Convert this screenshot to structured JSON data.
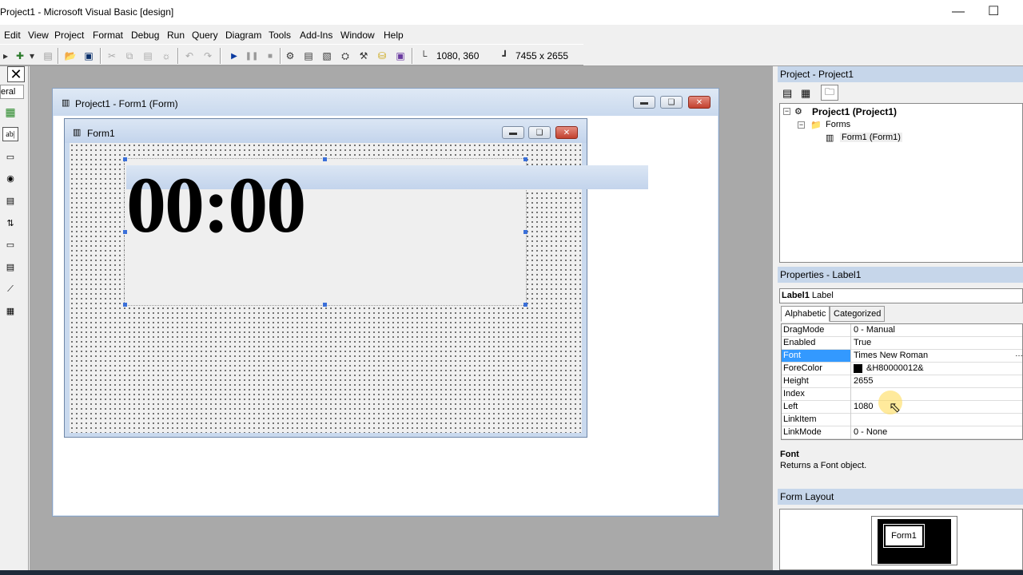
{
  "window": {
    "title": "Project1 - Microsoft Visual Basic [design]"
  },
  "menu": [
    "Edit",
    "View",
    "Project",
    "Format",
    "Debug",
    "Run",
    "Query",
    "Diagram",
    "Tools",
    "Add-Ins",
    "Window",
    "Help"
  ],
  "toolbar": {
    "position": "1080, 360",
    "size": "7455 x 2655"
  },
  "toolbox": {
    "tab_label": "eral",
    "text_tool": "ab|"
  },
  "designer": {
    "outer_title": "Project1 - Form1 (Form)",
    "form_title": "Form1",
    "label_caption": "00:00"
  },
  "project": {
    "title": "Project - Project1",
    "root": "Project1 (Project1)",
    "folder": "Forms",
    "item": "Form1 (Form1)"
  },
  "properties": {
    "title": "Properties - Label1",
    "object_name": "Label1",
    "object_type": "Label",
    "tabs": [
      "Alphabetic",
      "Categorized"
    ],
    "rows": [
      {
        "name": "DragMode",
        "value": "0 - Manual"
      },
      {
        "name": "Enabled",
        "value": "True"
      },
      {
        "name": "Font",
        "value": "Times New Roman"
      },
      {
        "name": "ForeColor",
        "value": "&H80000012&"
      },
      {
        "name": "Height",
        "value": "2655"
      },
      {
        "name": "Index",
        "value": ""
      },
      {
        "name": "Left",
        "value": "1080"
      },
      {
        "name": "LinkItem",
        "value": ""
      },
      {
        "name": "LinkMode",
        "value": "0 - None"
      }
    ],
    "desc_title": "Font",
    "desc_text": "Returns a Font object."
  },
  "layout": {
    "title": "Form Layout",
    "mini_form": "Form1"
  },
  "colors": {
    "selection": "#3399ff",
    "pane_header": "#c6d6ea",
    "workspace": "#a9a9a9"
  }
}
